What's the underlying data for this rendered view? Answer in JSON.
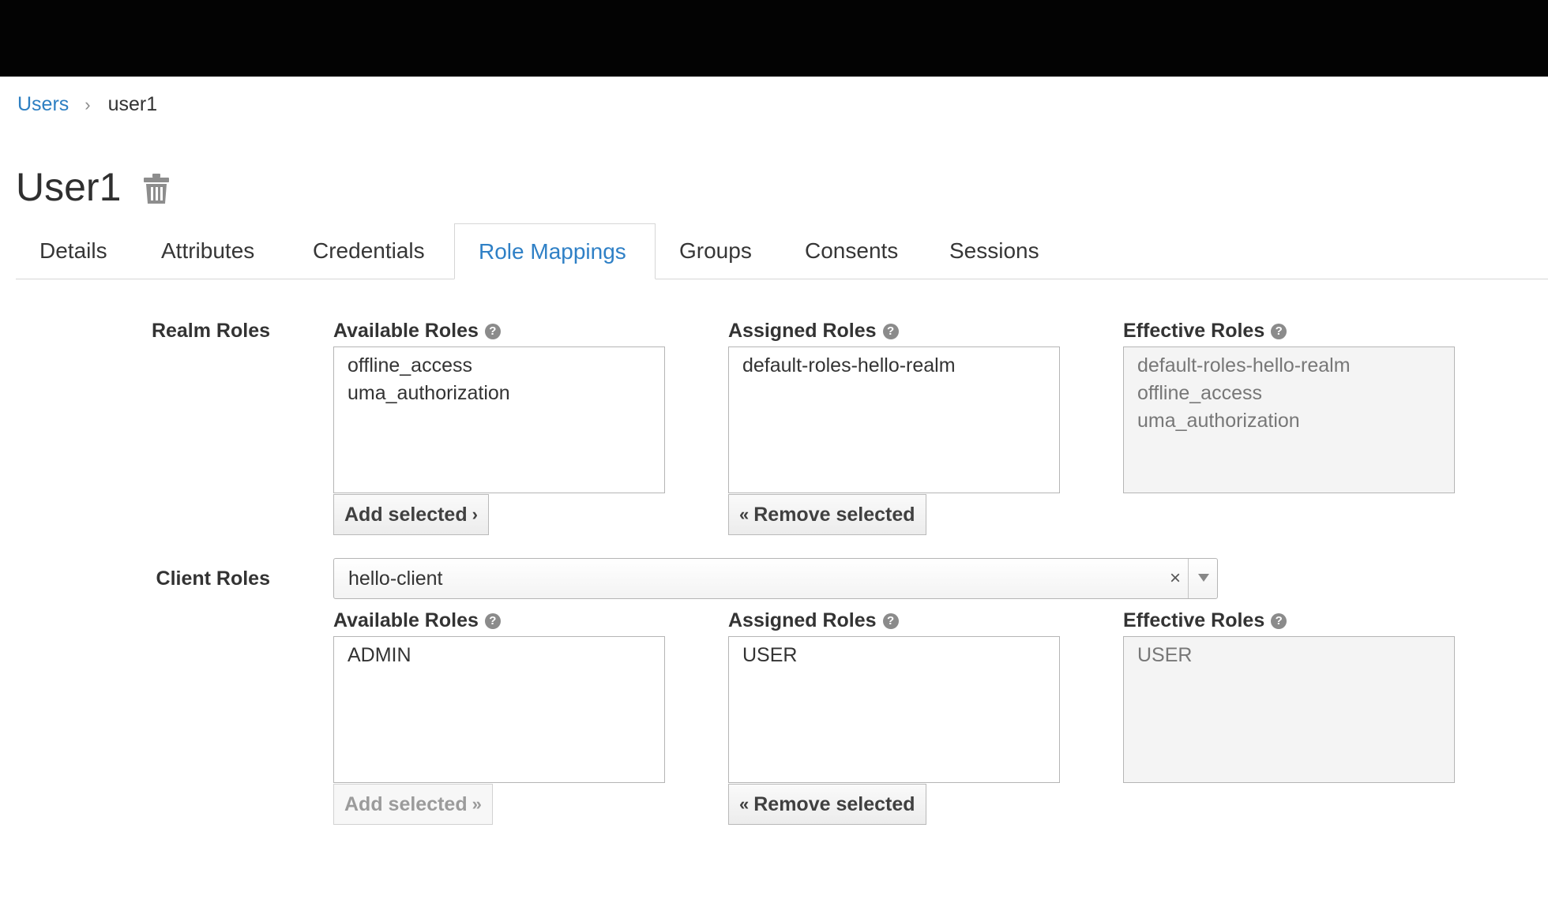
{
  "breadcrumb": {
    "parent": "Users",
    "separator": "›",
    "current": "user1"
  },
  "page": {
    "title": "User1"
  },
  "tabs": [
    {
      "label": "Details"
    },
    {
      "label": "Attributes"
    },
    {
      "label": "Credentials"
    },
    {
      "label": "Role Mappings",
      "active": true
    },
    {
      "label": "Groups"
    },
    {
      "label": "Consents"
    },
    {
      "label": "Sessions"
    }
  ],
  "help_glyph": "?",
  "realm_roles": {
    "label": "Realm Roles",
    "available": {
      "label": "Available Roles",
      "items": [
        "offline_access",
        "uma_authorization"
      ]
    },
    "assigned": {
      "label": "Assigned Roles",
      "items": [
        "default-roles-hello-realm"
      ]
    },
    "effective": {
      "label": "Effective Roles",
      "items": [
        "default-roles-hello-realm",
        "offline_access",
        "uma_authorization"
      ]
    },
    "add_button": "Add selected",
    "add_chevron": "›",
    "remove_button": "Remove selected",
    "remove_chevron": "«"
  },
  "client_roles": {
    "label": "Client Roles",
    "client_select": {
      "value": "hello-client",
      "clear": "×"
    },
    "available": {
      "label": "Available Roles",
      "items": [
        "ADMIN"
      ]
    },
    "assigned": {
      "label": "Assigned Roles",
      "items": [
        "USER"
      ]
    },
    "effective": {
      "label": "Effective Roles",
      "items": [
        "USER"
      ]
    },
    "add_button": "Add selected",
    "add_chevron": "»",
    "add_disabled": true,
    "remove_button": "Remove selected",
    "remove_chevron": "«"
  },
  "colors": {
    "link": "#2d7fc2",
    "active_tab": "#2f80c6",
    "topbar": "#030303"
  },
  "icons": {
    "delete": "trash-icon",
    "help": "question-circle-icon",
    "dropdown": "caret-down-icon"
  }
}
